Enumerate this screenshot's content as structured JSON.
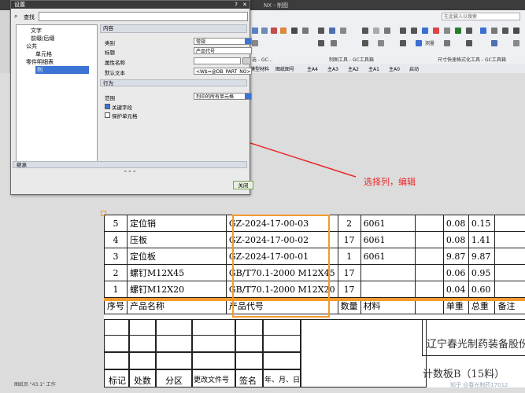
{
  "nx": {
    "title": "NX - 制图",
    "search_placeholder": "在此输入以搜索",
    "toolbar_labels": [
      "选 - GC...",
      "制图工具 - GC工具箱",
      "尺寸快速格式化工具 - GC工具箱"
    ],
    "bar2": [
      "模型材料",
      "图纸图号",
      "主A4",
      "主A3",
      "主A2",
      "主A1",
      "主A0",
      "启动"
    ],
    "measure_label": "测量",
    "status": "图纸页 \"43.1\" 工作"
  },
  "dialog": {
    "title": "设置",
    "search_label": "查找",
    "tree": [
      "文字",
      "前缀/后缀",
      "公共",
      "单元格",
      "零件明细表",
      "列"
    ],
    "section_content": "内容",
    "fields": [
      {
        "label": "类别",
        "value": "常规"
      },
      {
        "label": "标题",
        "value": "产品代号"
      },
      {
        "label": "属性名称",
        "value": ""
      },
      {
        "label": "默认文本",
        "value": "<W$=@DB_PART_NO>"
      }
    ],
    "section_behavior": "行为",
    "scope_label": "范围",
    "scope_value": "列中的所有单元格",
    "key_field": "关键字段",
    "protect_cells": "保护单元格",
    "inherit": "继承",
    "close": "关闭"
  },
  "annotation": "选择列，编辑",
  "bom": {
    "rows": [
      [
        "5",
        "定位销",
        "GZ-2024-17-00-03",
        "2",
        "6061",
        "",
        "0.08",
        "0.15",
        ""
      ],
      [
        "4",
        "压板",
        "GZ-2024-17-00-02",
        "17",
        "6061",
        "",
        "0.08",
        "1.41",
        ""
      ],
      [
        "3",
        "定位板",
        "GZ-2024-17-00-01",
        "1",
        "6061",
        "",
        "9.87",
        "9.87",
        ""
      ],
      [
        "2",
        "螺钉M12X45",
        "GB/T70.1-2000 M12X45",
        "17",
        "",
        "",
        "0.06",
        "0.95",
        ""
      ],
      [
        "1",
        "螺钉M12X20",
        "GB/T70.1-2000 M12X20",
        "17",
        "",
        "",
        "0.04",
        "0.60",
        ""
      ],
      [
        "序号",
        "产品名称",
        "产品代号",
        "数量",
        "材料",
        "",
        "单重",
        "总重",
        "备注"
      ]
    ],
    "titleblock": [
      "标记",
      "处数",
      "分区",
      "更改文件号",
      "签名",
      "年、月、日"
    ],
    "company": "辽宁春光制药装备股份有限",
    "drawing_no": "计数板B（15料）",
    "highlight_color": "#f39a2d"
  },
  "watermark": "知乎 @春光制药17012"
}
